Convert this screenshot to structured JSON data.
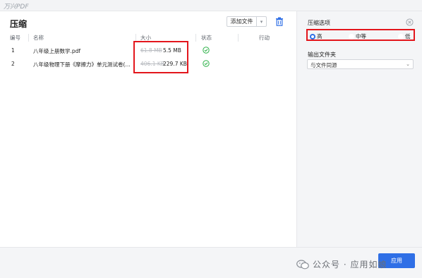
{
  "window": {
    "app_title": "万兴PDF"
  },
  "page": {
    "title": "压缩"
  },
  "toolbar": {
    "add_files_label": "添加文件",
    "dropdown_glyph": "▾",
    "icons": [
      "chevron-down-icon",
      "delete-icon"
    ]
  },
  "table": {
    "columns": [
      "编号",
      "名称",
      "大小",
      "状态",
      "行动"
    ],
    "rows": [
      {
        "index": "1",
        "name": "八年级上册数学.pdf",
        "old_size": "61.8 MB",
        "new_size": "5.5 MB",
        "status": "done"
      },
      {
        "index": "2",
        "name": "八年级物理下册《摩擦力》单元测试卷(…",
        "old_size": "406.1 KB",
        "new_size": "229.7 KB",
        "status": "done"
      }
    ]
  },
  "sidebar": {
    "compress_options_title": "压缩选项",
    "levels": [
      {
        "label": "高",
        "selected": true
      },
      {
        "label": "中等",
        "selected": false
      },
      {
        "label": "低",
        "selected": false
      }
    ],
    "output_folder_title": "输出文件夹",
    "output_folder_value": "与文件同源",
    "chevron_glyph": "⌄"
  },
  "footer": {
    "apply_label": "应用"
  },
  "watermark": {
    "text": "公众号 · 应用如娘"
  },
  "colors": {
    "accent": "#2f6fe6",
    "highlight": "#e3161c",
    "success": "#2fb24a",
    "sidebar_bg": "#f4f5f7"
  }
}
